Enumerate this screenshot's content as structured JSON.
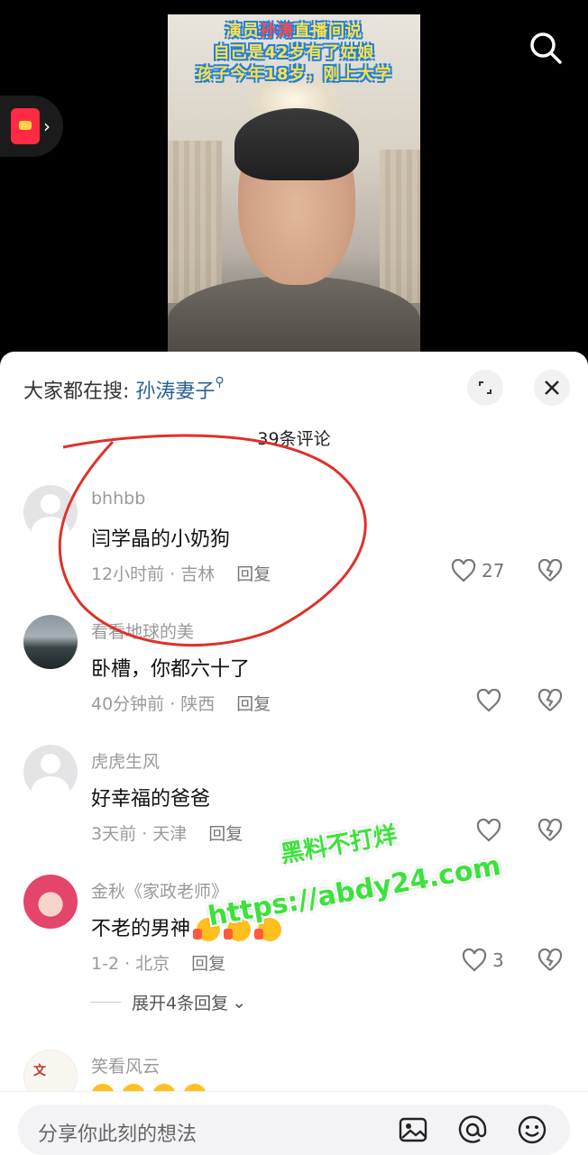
{
  "video": {
    "overlay_lines": [
      {
        "before": "演员",
        "highlight": "孙涛",
        "after": "直播间说"
      },
      {
        "before": "自己是42岁有了姑娘",
        "highlight": "",
        "after": ""
      },
      {
        "before": "孩子今年18岁，刚上大学",
        "highlight": "",
        "after": ""
      }
    ]
  },
  "hot_search": {
    "prefix": "大家都在搜: ",
    "term": "孙涛妻子"
  },
  "comments_count": "39条评论",
  "comments": [
    {
      "name": "bhhbb",
      "text": "闫学晶的小奶狗",
      "meta": "12小时前 · 吉林",
      "reply": "回复",
      "likes": "27",
      "avatar": "default-avatar"
    },
    {
      "name": "看看地球的美",
      "text": "卧槽，你都六十了",
      "meta": "40分钟前 · 陕西",
      "reply": "回复",
      "likes": "",
      "avatar": "mountain-avatar"
    },
    {
      "name": "虎虎生风",
      "text": "好幸福的爸爸",
      "meta": "3天前 · 天津",
      "reply": "回复",
      "likes": "",
      "avatar": "default-avatar"
    },
    {
      "name": "金秋《家政老师》",
      "text": "不老的男神",
      "meta": "1-2 · 北京",
      "reply": "回复",
      "likes": "3",
      "avatar": "girl-avatar",
      "emoji_count": 3
    },
    {
      "name": "笑看风云",
      "text": "",
      "meta": "",
      "reply": "",
      "likes": "",
      "avatar": "art-avatar"
    }
  ],
  "expand_replies": "展开4条回复",
  "input": {
    "placeholder": "分享你此刻的想法"
  },
  "watermark": {
    "line1": "黑料不打烊",
    "line2": "https://abdy24.com"
  },
  "colors": {
    "accent_link": "#2a5f96",
    "annotation_red": "#e0302a",
    "watermark_green": "#3be23b"
  }
}
